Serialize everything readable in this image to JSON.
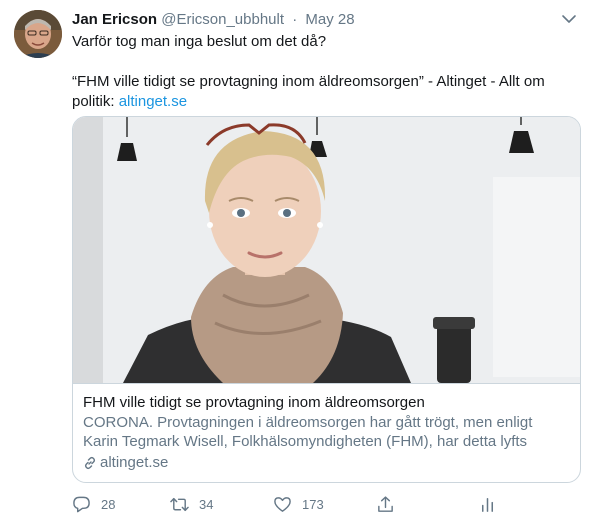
{
  "author": {
    "name": "Jan Ericson",
    "handle": "@Ericson_ubbhult",
    "separator": "·",
    "date": "May 28"
  },
  "tweet": {
    "line1": "Varför tog man inga beslut om det då?",
    "line2": "“FHM ville tidigt se provtagning inom äldreomsorgen” - Altinget - Allt om",
    "line3_prefix": "politik: ",
    "link_text": "altinget.se"
  },
  "card": {
    "title": "FHM ville tidigt se provtagning inom äldreomsorgen",
    "description": "CORONA. Provtagningen i äldreomsorgen har gått trögt, men enligt Karin Tegmark Wisell, Folkhälsomyndigheten (FHM), har detta lyfts fram...",
    "domain": "altinget.se"
  },
  "actions": {
    "reply_count": "28",
    "retweet_count": "34",
    "like_count": "173"
  },
  "colors": {
    "link": "#1b95e0",
    "secondary_text": "#657786",
    "border": "#ccd6dd"
  },
  "icons": [
    "reply-icon",
    "retweet-icon",
    "like-icon",
    "share-icon",
    "stats-icon",
    "link-icon",
    "caret-down-icon"
  ]
}
